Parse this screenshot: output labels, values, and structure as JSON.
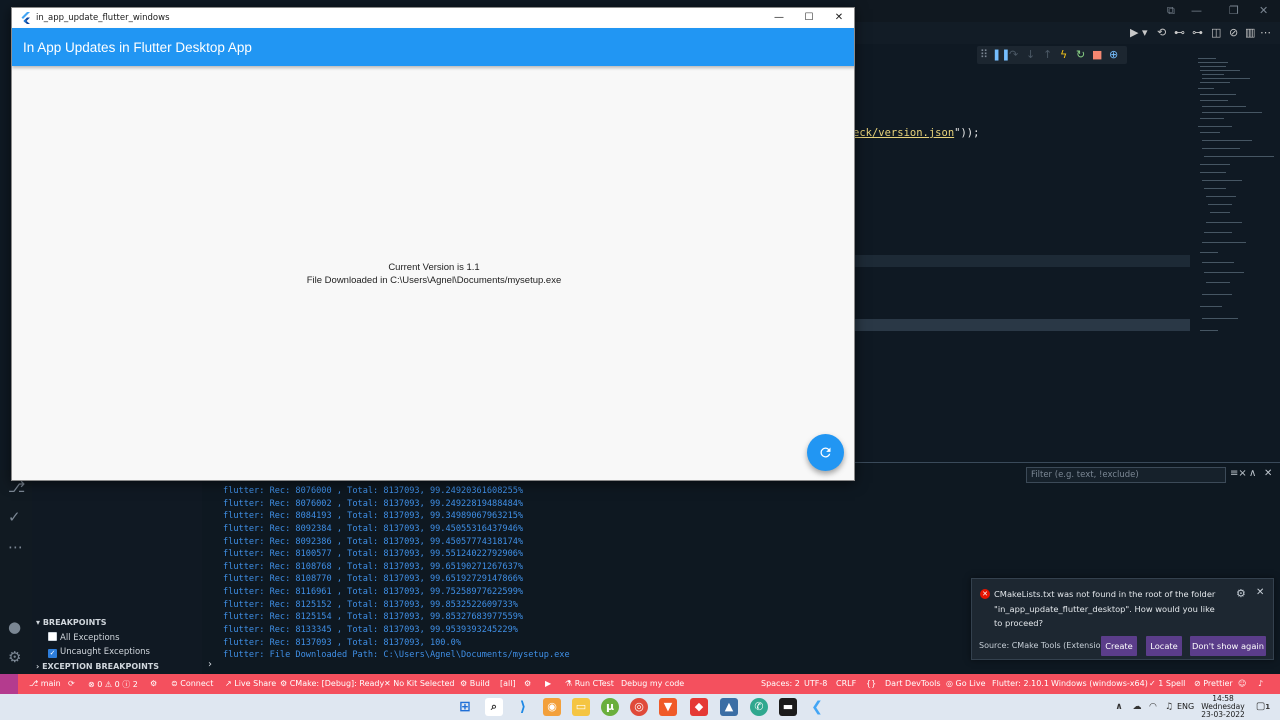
{
  "flutter_window": {
    "title": "in_app_update_flutter_windows",
    "minimize": "—",
    "maximize": "☐",
    "close": "✕",
    "appbar_title": "In App Updates in Flutter Desktop App",
    "current_version": "Current Version is 1.1",
    "download_status": "File Downloaded in C:\\Users\\Agnel\\Documents/mysetup.exe",
    "fab_icon": "refresh-icon",
    "accent": "#2196f3"
  },
  "editor": {
    "code_prefix": "eck/version.json",
    "code_suffix": "\"));"
  },
  "sidebar": {
    "breakpoints_header": "BREAKPOINTS",
    "all_exceptions": "All Exceptions",
    "uncaught_exceptions": "Uncaught Exceptions",
    "exception_breakpoints_header": "EXCEPTION BREAKPOINTS"
  },
  "panel": {
    "filter_placeholder": "Filter (e.g. text, !exclude)",
    "console_lines": [
      "flutter: Rec: 8076000 , Total: 8137093, 99.24920361608255%",
      "flutter: Rec: 8076002 , Total: 8137093, 99.24922819488484%",
      "flutter: Rec: 8084193 , Total: 8137093, 99.34989067963215%",
      "flutter: Rec: 8092384 , Total: 8137093, 99.45055316437946%",
      "flutter: Rec: 8092386 , Total: 8137093, 99.45057774318174%",
      "flutter: Rec: 8100577 , Total: 8137093, 99.55124022792906%",
      "flutter: Rec: 8108768 , Total: 8137093, 99.65190271267637%",
      "flutter: Rec: 8108770 , Total: 8137093, 99.65192729147866%",
      "flutter: Rec: 8116961 , Total: 8137093, 99.75258977622599%",
      "flutter: Rec: 8125152 , Total: 8137093, 99.8532522609733%",
      "flutter: Rec: 8125154 , Total: 8137093, 99.85327683977559%",
      "flutter: Rec: 8133345 , Total: 8137093, 99.9539393245229%",
      "flutter: Rec: 8137093 , Total: 8137093, 100.0%",
      "flutter: File Downloaded Path: C:\\Users\\Agnel\\Documents/mysetup.exe"
    ]
  },
  "notification": {
    "message": "CMakeLists.txt was not found in the root of the folder \"in_app_update_flutter_desktop\". How would you like to proceed?",
    "source": "Source: CMake Tools (Extension)",
    "create": "Create",
    "locate": "Locate",
    "dont_show": "Don't show again"
  },
  "statusbar": {
    "branch": "main",
    "errors": "0",
    "warnings": "0",
    "info": "2",
    "connect": "Connect",
    "live_share": "Live Share",
    "cmake": "CMake: [Debug]: Ready",
    "kit": "No Kit Selected",
    "build": "Build",
    "all": "[all]",
    "run_ctest": "Run CTest",
    "debug_code": "Debug my code",
    "spaces": "Spaces: 2",
    "encoding": "UTF-8",
    "eol": "CRLF",
    "lang": "{}",
    "devtools": "Dart DevTools",
    "go_live": "Go Live",
    "flutter_ver": "Flutter: 2.10.1",
    "device": "Windows (windows-x64)",
    "spell": "1 Spell",
    "prettier": "Prettier",
    "background": "#f4505e"
  },
  "taskbar": {
    "lang": "ENG",
    "time": "14:58",
    "day": "Wednesday",
    "date": "23-03-2022",
    "notifications": "1"
  }
}
